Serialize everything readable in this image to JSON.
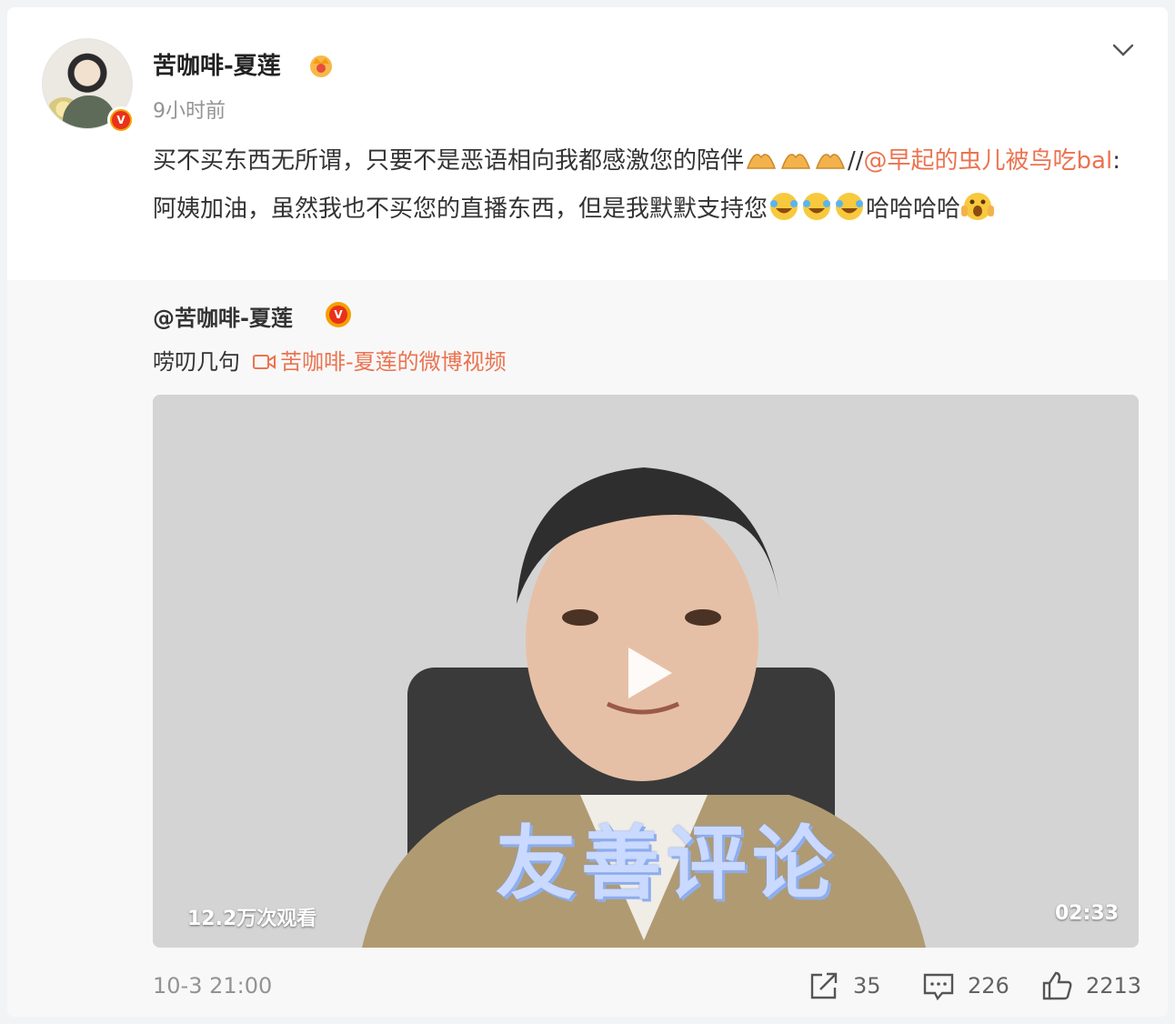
{
  "author": {
    "name": "苦咖啡-夏莲",
    "time": "9小时前",
    "verified_badge": "V"
  },
  "post": {
    "text_1": "买不买东西无所谓，只要不是恶语相向我都感激您的陪伴",
    "sep": "//",
    "mention": "@早起的虫儿被鸟吃bal",
    "text_2": ":阿姨加油，虽然我也不买您的直播东西，但是我默默支持您",
    "text_3": "哈哈哈哈"
  },
  "repost": {
    "author": "@苦咖啡-夏莲",
    "text": "唠叨几句",
    "video_link": "苦咖啡-夏莲的微博视频",
    "video": {
      "views": "12.2万次观看",
      "duration": "02:33",
      "caption": "友善评论"
    }
  },
  "footer": {
    "time": "10-3 21:00",
    "reposts": "35",
    "comments": "226",
    "likes": "2213"
  },
  "colors": {
    "accent": "#eb7350",
    "muted": "#939393",
    "badge": "#f5a000"
  },
  "icons": [
    "crown-icon",
    "chevron-down-icon",
    "pray-icon",
    "laugh-cry-icon",
    "scream-icon",
    "video-link-icon",
    "play-icon",
    "share-icon",
    "comment-icon",
    "thumbs-up-icon"
  ]
}
